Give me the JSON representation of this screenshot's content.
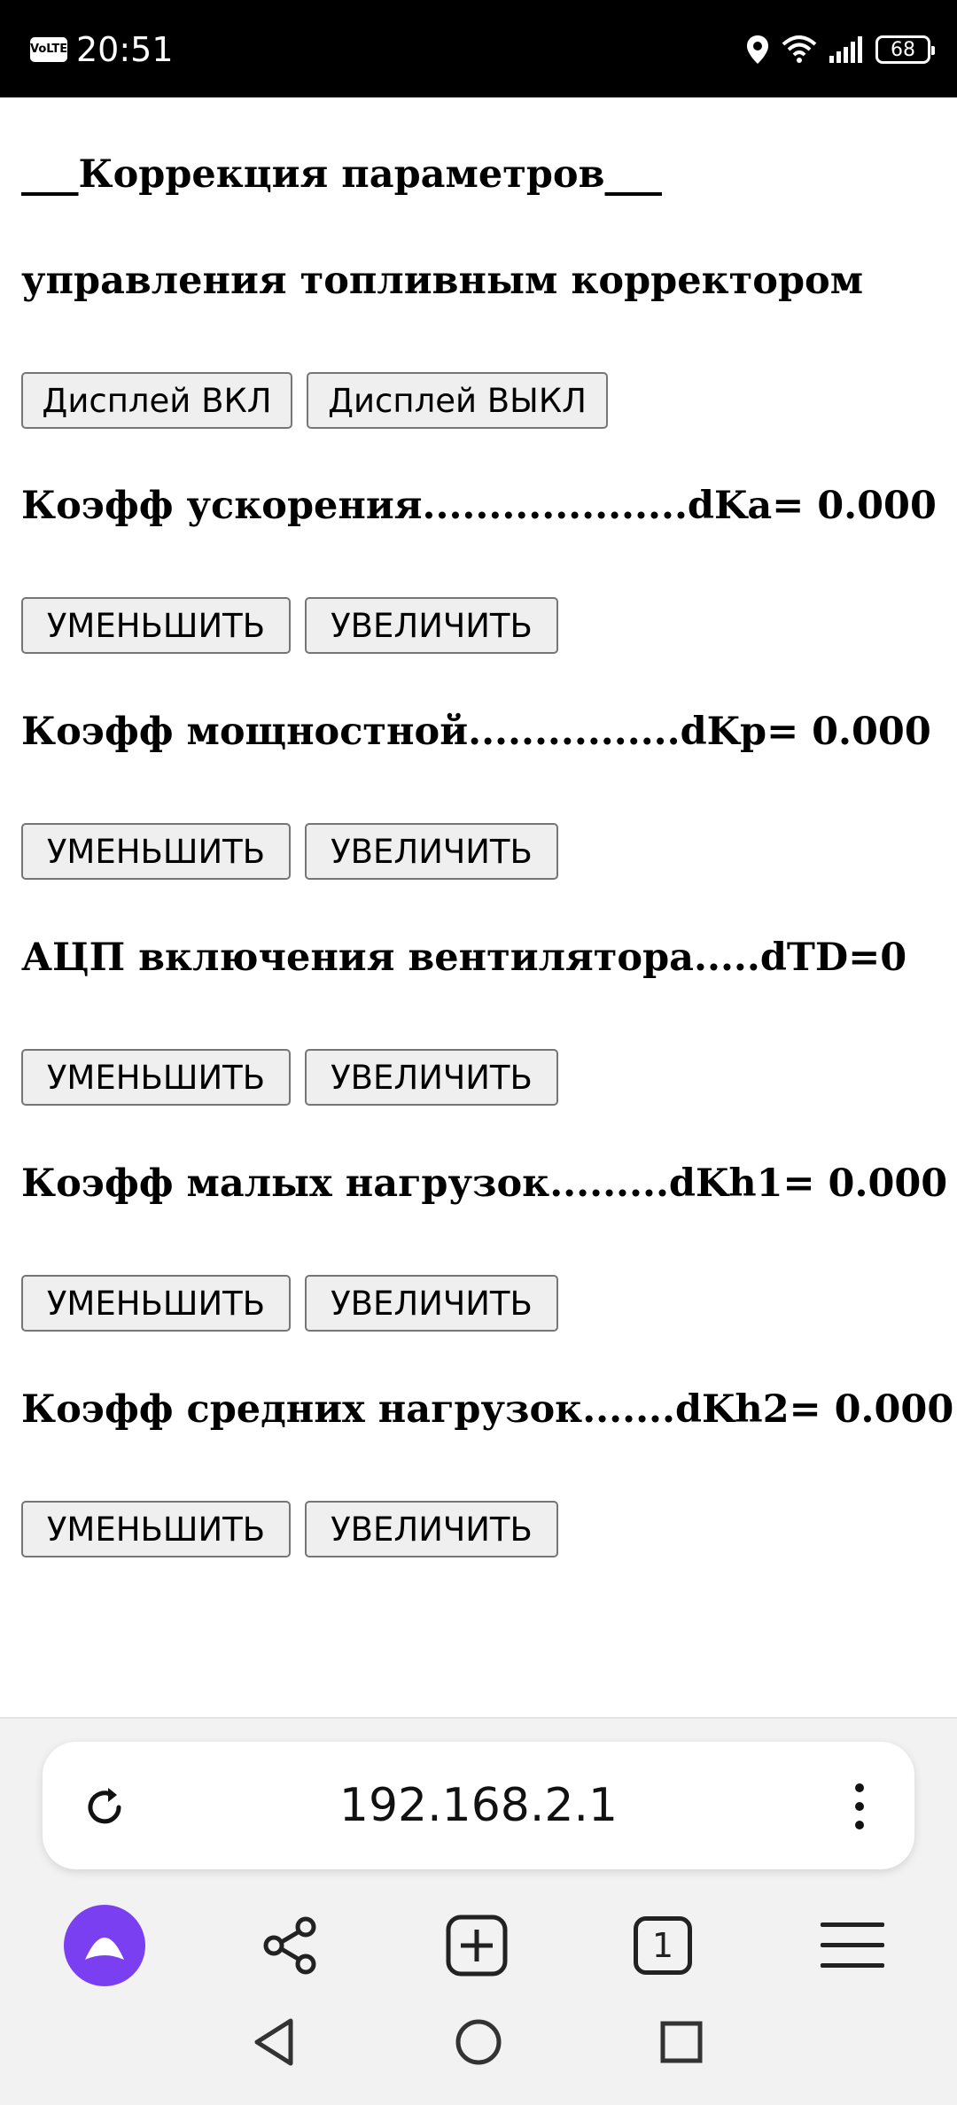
{
  "status_bar": {
    "network_badge": "VoLTE",
    "time": "20:51",
    "battery": "68",
    "icons": [
      "location-icon",
      "wifi-icon",
      "signal-icon",
      "battery-icon"
    ]
  },
  "page": {
    "title_line1": "___Коррекция параметров___",
    "title_line2": "управления топливным корректором",
    "display_buttons": {
      "on": "Дисплей ВКЛ",
      "off": "Дисплей ВЫКЛ"
    },
    "params": [
      {
        "label": "Коэфф ускорения....................dKa= 0.000",
        "decrease": "УМЕНЬШИТЬ",
        "increase": "УВЕЛИЧИТЬ"
      },
      {
        "label": "Коэфф мощностной................dKp= 0.000",
        "decrease": "УМЕНЬШИТЬ",
        "increase": "УВЕЛИЧИТЬ"
      },
      {
        "label": "АЦП включения вентилятора.....dTD=0",
        "decrease": "УМЕНЬШИТЬ",
        "increase": "УВЕЛИЧИТЬ"
      },
      {
        "label": "Коэфф малых нагрузок.........dKh1= 0.000",
        "decrease": "УМЕНЬШИТЬ",
        "increase": "УВЕЛИЧИТЬ"
      },
      {
        "label": "Коэфф средних нагрузок.......dKh2= 0.000",
        "decrease": "УМЕНЬШИТЬ",
        "increase": "УВЕЛИЧИТЬ"
      }
    ]
  },
  "browser": {
    "url": "192.168.2.1",
    "tab_count": "1",
    "accent_color": "#7b3ff2"
  }
}
